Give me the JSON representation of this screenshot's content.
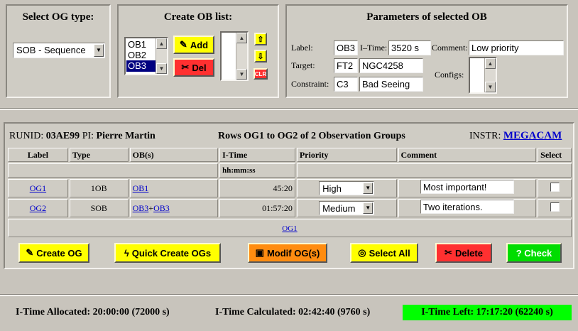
{
  "og_type": {
    "title": "Select OG type:",
    "selected": "SOB - Sequence"
  },
  "ob_list": {
    "title": "Create OB list:",
    "items": [
      "OB1",
      "OB2",
      "OB3"
    ],
    "selected_index": 2,
    "add_label": "Add",
    "del_label": "Del",
    "clr_label": "CLR"
  },
  "params": {
    "title": "Parameters of selected OB",
    "label_caption": "Label:",
    "label_value": "OB3",
    "itime_caption": "I–Time:",
    "itime_value": "3520 s",
    "comment_caption": "Comment:",
    "comment_value": "Low priority",
    "target_caption": "Target:",
    "target_code": "FT2",
    "target_name": "NGC4258",
    "configs_caption": "Configs:",
    "constraint_caption": "Constraint:",
    "constraint_code": "C3",
    "constraint_name": "Bad Seeing"
  },
  "summary": {
    "runid_caption": "RUNID:",
    "runid": "03AE99",
    "pi_caption": "PI:",
    "pi": "Pierre Martin",
    "rows_text": "Rows OG1 to OG2 of 2 Observation Groups",
    "instr_caption": "INSTR:",
    "instr": "MEGACAM"
  },
  "table": {
    "headers": [
      "Label",
      "Type",
      "OB(s)",
      "I-Time",
      "Priority",
      "Comment",
      "Select"
    ],
    "subheader_itime": "hh:mm:ss",
    "rows": [
      {
        "label": "OG1",
        "type": "1OB",
        "obs": [
          "OB1"
        ],
        "obs_sep": "",
        "itime": "45:20",
        "priority": "High",
        "comment": "Most important!"
      },
      {
        "label": "OG2",
        "type": "SOB",
        "obs": [
          "OB3",
          "OB3"
        ],
        "obs_sep": "+",
        "itime": "01:57:20",
        "priority": "Medium",
        "comment": "Two iterations."
      }
    ],
    "page_link": "OG1"
  },
  "actions": {
    "create": "Create OG",
    "quick": "Quick Create OGs",
    "modif": "Modif OG(s)",
    "select_all": "Select All",
    "delete": "Delete",
    "check": "? Check"
  },
  "status": {
    "allocated": "I-Time Allocated: 20:00:00 (72000 s)",
    "calculated": "I-Time Calculated: 02:42:40 (9760 s)",
    "left": "I-Time Left: 17:17:20 (62240 s)"
  },
  "colors": {
    "yellow": "#ffff00",
    "red": "#ff3030",
    "orange": "#ff8c10",
    "green": "#00dd00",
    "link": "#0000cc",
    "selection": "#000080"
  }
}
